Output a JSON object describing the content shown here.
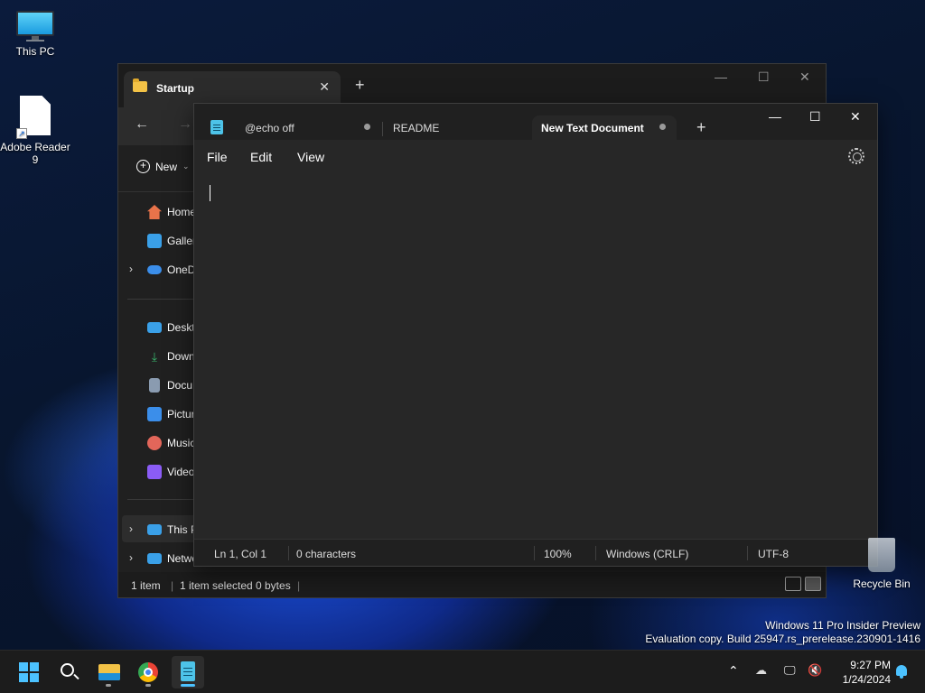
{
  "desktop": {
    "icons": [
      {
        "label": "This PC",
        "icon": "monitor-icon"
      },
      {
        "label": "Adobe Reader\n9",
        "icon": "document-shortcut-icon"
      }
    ],
    "recycle_bin": "Recycle Bin",
    "watermark": {
      "line1": "Windows 11 Pro Insider Preview",
      "line2": "Evaluation copy. Build 25947.rs_prerelease.230901-1416"
    }
  },
  "explorer": {
    "tab_title": "Startup",
    "new_label": "New",
    "sidebar": {
      "items": [
        {
          "label": "Home",
          "icon": "home-icon",
          "color": "#e8734a"
        },
        {
          "label": "Galler",
          "icon": "gallery-icon",
          "color": "#3aa0e8"
        },
        {
          "label": "OneD",
          "icon": "onedrive-icon",
          "color": "#3b8eea"
        },
        {
          "label": "Deskt",
          "icon": "desktop-icon",
          "color": "#3aa0e8"
        },
        {
          "label": "Down",
          "icon": "download-icon",
          "color": "#38b36b"
        },
        {
          "label": "Docu",
          "icon": "document-icon",
          "color": "#8a9bb0"
        },
        {
          "label": "Pictur",
          "icon": "pictures-icon",
          "color": "#3b8eea"
        },
        {
          "label": "Music",
          "icon": "music-icon",
          "color": "#e2665a"
        },
        {
          "label": "Video",
          "icon": "video-icon",
          "color": "#8b5cf6"
        },
        {
          "label": "This P",
          "icon": "this-pc-icon",
          "color": "#3aa0e8"
        },
        {
          "label": "Netwo",
          "icon": "network-icon",
          "color": "#3aa0e8"
        }
      ]
    },
    "status": {
      "count": "1 item",
      "selected": "1 item selected",
      "size": "0 bytes",
      "pipe": "|"
    }
  },
  "notepad": {
    "tabs": [
      {
        "label": "@echo off",
        "modified": true,
        "active": false
      },
      {
        "label": "README",
        "modified": false,
        "active": false
      },
      {
        "label": "New Text Document",
        "modified": true,
        "active": true
      }
    ],
    "menu": {
      "file": "File",
      "edit": "Edit",
      "view": "View"
    },
    "status": {
      "position": "Ln 1, Col 1",
      "characters": "0 characters",
      "zoom": "100%",
      "line_ending": "Windows (CRLF)",
      "encoding": "UTF-8"
    }
  },
  "taskbar": {
    "apps": [
      "start-icon",
      "search-icon",
      "file-explorer-icon",
      "chrome-icon",
      "notepad-icon"
    ],
    "time": "9:27 PM",
    "date": "1/24/2024",
    "accent": "#4cc2ff"
  }
}
